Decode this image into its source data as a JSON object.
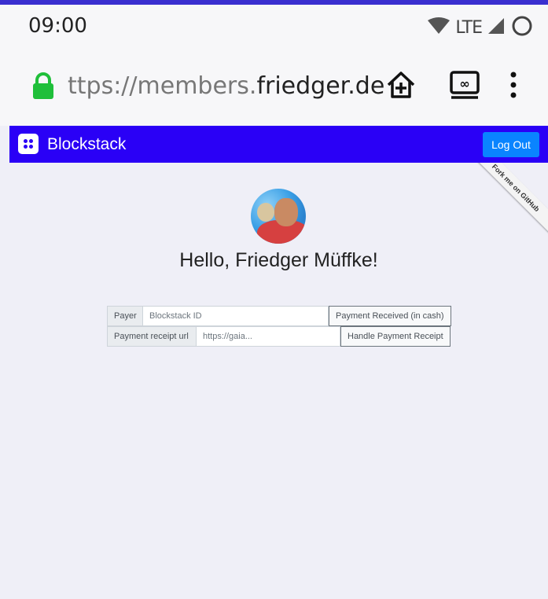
{
  "status_bar": {
    "time": "09:00",
    "network": "LTE"
  },
  "browser": {
    "url_prefix": "ttps://members.",
    "url_host": "friedger.de"
  },
  "navbar": {
    "brand": "Blockstack",
    "logout_label": "Log Out"
  },
  "ribbon": "Fork me on GitHub",
  "greeting": "Hello, Friedger Müffke!",
  "forms": {
    "payer_label": "Payer",
    "payer_placeholder": "Blockstack ID",
    "payer_action": "Payment Received (in cash)",
    "receipt_label": "Payment receipt url",
    "receipt_placeholder": "https://gaia...",
    "receipt_action": "Handle Payment Receipt"
  },
  "colors": {
    "navbar": "#2a00f6",
    "logout_button": "#0a84ff",
    "lock": "#1fbf3a",
    "background": "#efeff7"
  },
  "icons": [
    "wifi-icon",
    "signal-icon",
    "battery-icon",
    "lock-icon",
    "add-to-home-icon",
    "tabs-icon",
    "more-menu-icon",
    "blockstack-logo-icon"
  ]
}
